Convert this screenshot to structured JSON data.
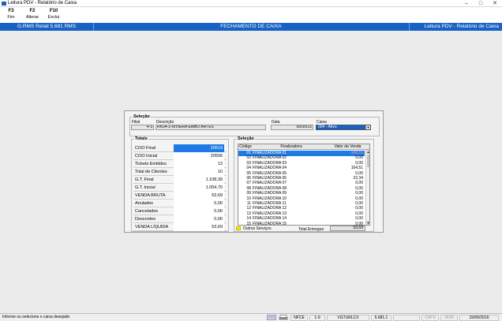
{
  "window": {
    "title": "Leitura PDV - Relatório de Caixa"
  },
  "toolbar": [
    {
      "key": "F3",
      "label": "Fim"
    },
    {
      "key": "F2",
      "label": "Alterar"
    },
    {
      "key": "F10",
      "label": "Exclui"
    }
  ],
  "header": {
    "left": "G.RMS Retail 5.681 RMS",
    "center": "FECHAMENTO DE CAIXA",
    "right": "Leitura PDV - Relatório de Caixa"
  },
  "selecao": {
    "title": "Seleção",
    "filial_label": "Filial",
    "filial_value": "4-3",
    "descricao_label": "Descrição",
    "descricao_value": "RK04-3 RIVIERA EMBO ARTES",
    "data_label": "Data",
    "data_value": "05/05/15",
    "caixa_label": "Caixa",
    "caixa_value": "004 - Ativo"
  },
  "totais": {
    "title": "Totais",
    "rows": [
      {
        "label": "COO Final",
        "value": "20519"
      },
      {
        "label": "COO Inicial",
        "value": "20506"
      },
      {
        "label": "Tickets Emitidos",
        "value": "13"
      },
      {
        "label": "Total de Clientes",
        "value": "10"
      },
      {
        "label": "G.T. Final",
        "value": "1.108,39"
      },
      {
        "label": "G.T. Inicial",
        "value": "1.054,70"
      },
      {
        "label": "VENDA BRUTA",
        "value": "53,69"
      },
      {
        "label": "Anulados",
        "value": "0,00"
      },
      {
        "label": "Cancelados",
        "value": "0,00"
      },
      {
        "label": "Descontos",
        "value": "0,00"
      },
      {
        "label": "VENDA LÍQUIDA",
        "value": "53,69"
      }
    ]
  },
  "grid": {
    "title": "Seleção",
    "columns": [
      "Código",
      "Finalizadora",
      "Valor da Venda"
    ],
    "rows": [
      {
        "code": "01",
        "name": "FINALIZADORA 01",
        "value": "-143,15"
      },
      {
        "code": "02",
        "name": "FINALIZADORA 02",
        "value": "0,00"
      },
      {
        "code": "03",
        "name": "FINALIZADORA 03",
        "value": "0,00"
      },
      {
        "code": "04",
        "name": "FINALIZADORA 04",
        "value": "164,51"
      },
      {
        "code": "05",
        "name": "FINALIZADORA 05",
        "value": "0,00"
      },
      {
        "code": "06",
        "name": "FINALIZADORA 06",
        "value": "22,34"
      },
      {
        "code": "07",
        "name": "FINALIZADORA 07",
        "value": "0,00"
      },
      {
        "code": "08",
        "name": "FINALIZADORA 08",
        "value": "0,00"
      },
      {
        "code": "09",
        "name": "FINALIZADORA 09",
        "value": "0,00"
      },
      {
        "code": "10",
        "name": "FINALIZADORA 10",
        "value": "0,00"
      },
      {
        "code": "11",
        "name": "FINALIZADORA 11",
        "value": "0,00"
      },
      {
        "code": "12",
        "name": "FINALIZADORA 12",
        "value": "0,00"
      },
      {
        "code": "13",
        "name": "FINALIZADORA 13",
        "value": "0,00"
      },
      {
        "code": "14",
        "name": "FINALIZADORA 14",
        "value": "0,00"
      },
      {
        "code": "15",
        "name": "FINALIZADORA 15",
        "value": "0,00"
      }
    ],
    "legend_label": "Outros Serviços",
    "total_label": "Total Entregue",
    "total_value": "53,69"
  },
  "statusbar": {
    "message": "Informe ou selecione o caixa desejado",
    "cells": [
      "NFCE",
      "1-9",
      "VGTURLCX",
      "5.681.1",
      "",
      "CAPS",
      "NUM",
      "15/06/2016"
    ]
  },
  "colors": {
    "header_blue": "#1762c4",
    "selection_blue": "#1e7be6",
    "legend_yellow": "#f7e51a"
  }
}
